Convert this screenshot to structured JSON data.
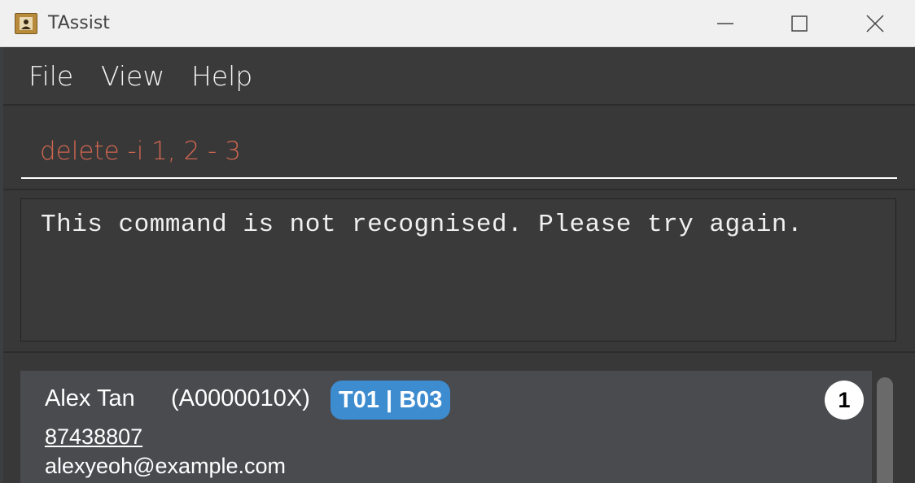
{
  "window": {
    "title": "TAssist",
    "icons": {
      "app": "contact-book-icon",
      "minimize": "minimize-icon",
      "maximize": "maximize-icon",
      "close": "close-icon"
    }
  },
  "menu": {
    "items": [
      {
        "label": "File"
      },
      {
        "label": "View"
      },
      {
        "label": "Help"
      }
    ]
  },
  "command": {
    "value": "delete -i 1, 2 - 3",
    "text_color": "#d06651"
  },
  "result": {
    "message": "This command is not recognised. Please try again."
  },
  "persons": [
    {
      "index": "1",
      "name": "Alex Tan",
      "matric": "(A0000010X)",
      "tag": "T01 | B03",
      "phone": "87438807",
      "email": "alexyeoh@example.com"
    }
  ],
  "colors": {
    "tag_background": "#3e8cd0",
    "card_background": "#4a4b4f",
    "app_background": "#383838"
  }
}
